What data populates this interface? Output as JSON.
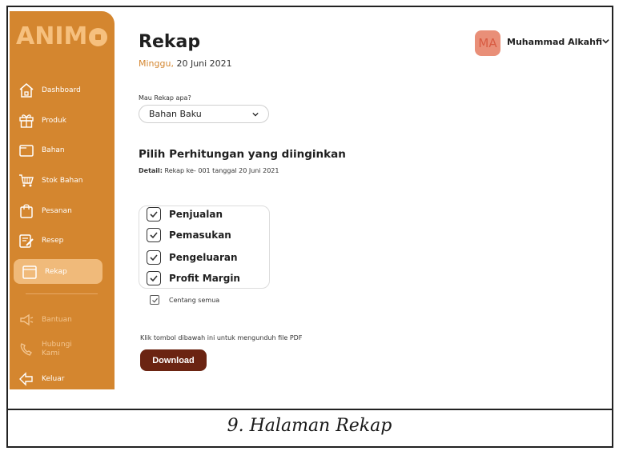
{
  "sidebar": {
    "logo_text": "ANIM",
    "items": [
      {
        "label": "Dashboard",
        "icon": "home-icon"
      },
      {
        "label": "Produk",
        "icon": "gift-icon"
      },
      {
        "label": "Bahan",
        "icon": "folder-icon"
      },
      {
        "label": "Stok Bahan",
        "icon": "cart-icon"
      },
      {
        "label": "Pesanan",
        "icon": "shopping-bag-icon"
      },
      {
        "label": "Resep",
        "icon": "recipe-icon"
      },
      {
        "label": "Rekap",
        "icon": "rekap-icon",
        "active": true
      },
      {
        "label": "Bantuan",
        "icon": "megaphone-icon",
        "muted": true
      },
      {
        "label": "Hubungi Kami",
        "icon": "phone-icon",
        "muted": true
      },
      {
        "label": "Keluar",
        "icon": "logout-icon"
      }
    ]
  },
  "header": {
    "title": "Rekap",
    "date_day": "Minggu,",
    "date_rest": " 20 Juni 2021",
    "user_initials": "MA",
    "user_name": "Muhammad Alkahfi"
  },
  "main": {
    "question_label": "Mau Rekap apa?",
    "select_value": "Bahan Baku",
    "section_title": "Pilih Perhitungan yang diinginkan",
    "detail_label": "Detail:",
    "detail_text": " Rekap ke-  001  tanggal  20 Juni  2021",
    "options": [
      {
        "label": "Penjualan",
        "checked": true
      },
      {
        "label": "Pemasukan",
        "checked": true
      },
      {
        "label": "Pengeluaran",
        "checked": true
      },
      {
        "label": "Profit Margin",
        "checked": true
      }
    ],
    "check_all_label": "Centang semua",
    "check_all_checked": true,
    "hint": "Klik tombol dibawah ini untuk mengunduh file PDF",
    "download_label": "Download"
  },
  "caption": "9.  Halaman Rekap",
  "colors": {
    "sidebar": "#d4862f",
    "accent_light": "#f0ba7a",
    "download_button": "#6b2412",
    "avatar": "#e98f78"
  }
}
